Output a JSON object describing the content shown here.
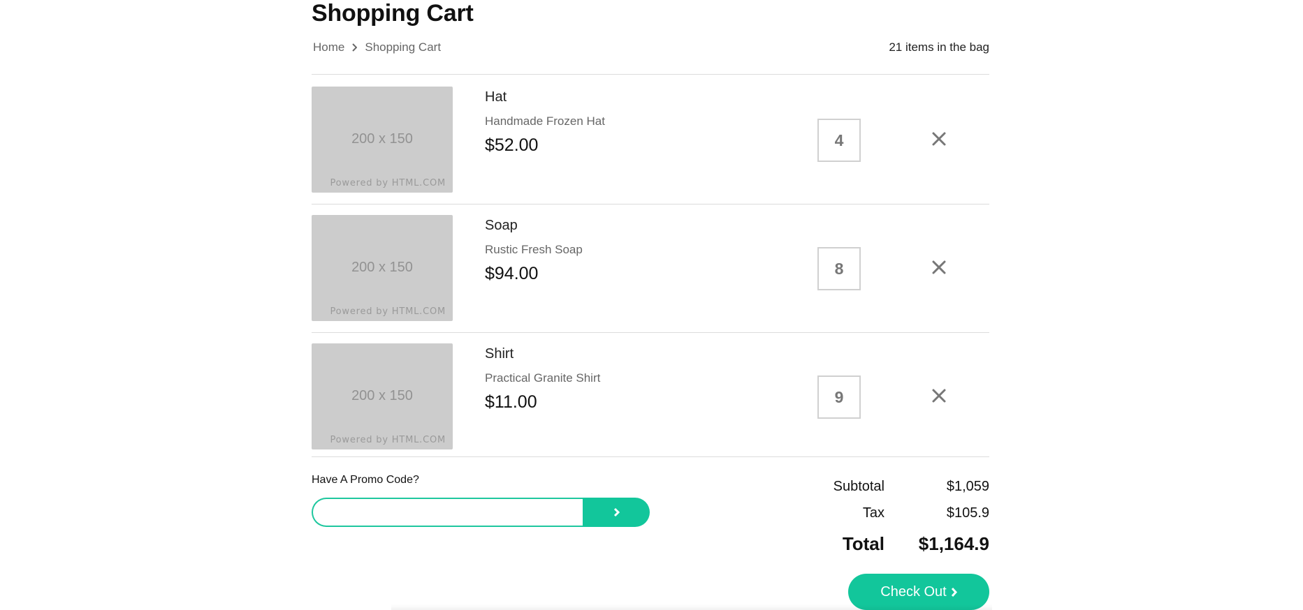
{
  "page": {
    "title": "Shopping Cart",
    "breadcrumb": {
      "home": "Home",
      "current": "Shopping Cart"
    },
    "bag_count": "21 items in the bag"
  },
  "items": [
    {
      "name": "Hat",
      "description": "Handmade Frozen Hat",
      "price": "$52.00",
      "quantity": "4",
      "image_text": "200 x 150",
      "image_caption": "Powered by HTML.COM"
    },
    {
      "name": "Soap",
      "description": "Rustic Fresh Soap",
      "price": "$94.00",
      "quantity": "8",
      "image_text": "200 x 150",
      "image_caption": "Powered by HTML.COM"
    },
    {
      "name": "Shirt",
      "description": "Practical Granite Shirt",
      "price": "$11.00",
      "quantity": "9",
      "image_text": "200 x 150",
      "image_caption": "Powered by HTML.COM"
    }
  ],
  "promo": {
    "label": "Have A Promo Code?",
    "value": "",
    "submit_icon": "chevron-right-icon"
  },
  "totals": {
    "subtotal_label": "Subtotal",
    "subtotal": "$1,059",
    "tax_label": "Tax",
    "tax": "$105.9",
    "total_label": "Total",
    "total": "$1,164.9"
  },
  "checkout": {
    "label": "Check Out",
    "icon": "chevron-right-icon"
  },
  "colors": {
    "accent": "#12c69b",
    "placeholder_bg": "#cccccc",
    "divider": "#dcdcdc"
  },
  "icons": {
    "remove": "close-icon",
    "breadcrumb_separator": "chevron-right-icon"
  }
}
